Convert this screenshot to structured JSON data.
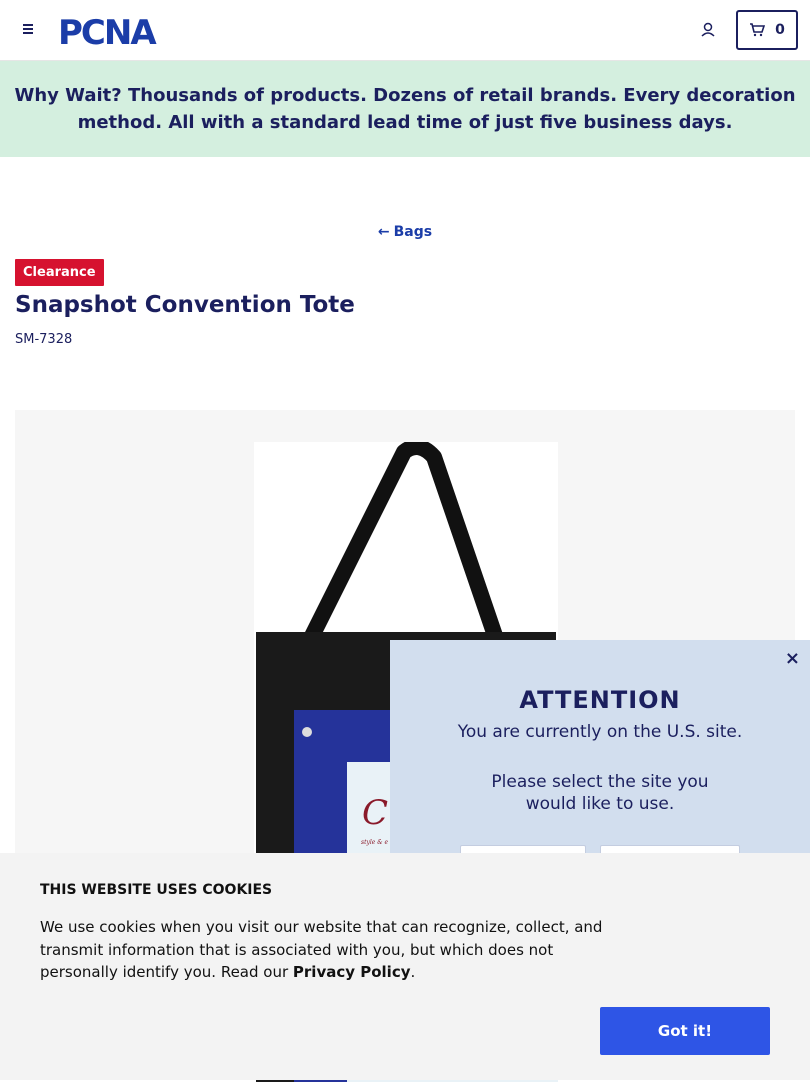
{
  "header": {
    "logo_text": "PCNA",
    "cart_count": "0"
  },
  "promo": {
    "text": "Why Wait? Thousands of products. Dozens of retail brands. Every decoration method. All with a standard lead time of just five business days."
  },
  "breadcrumb": {
    "back_label": "Bags"
  },
  "product": {
    "badge": "Clearance",
    "title": "Snapshot Convention Tote",
    "sku": "SM-7328"
  },
  "attention_modal": {
    "close": "×",
    "title": "ATTENTION",
    "line1": "You are currently on the U.S. site.",
    "line2": "Please select the site you would like to use."
  },
  "cookie_banner": {
    "title": "THIS WEBSITE USES COOKIES",
    "body": "We use cookies when you visit our website that can recognize, collect, and transmit information that is associated with you, but which does not personally identify you. Read our ",
    "link": "Privacy Policy",
    "period": ".",
    "button": "Got it!"
  },
  "colors": {
    "brand_navy": "#1b1f5e",
    "promo_bg": "#d4efdf",
    "clearance_red": "#d6122f",
    "modal_bg": "#d2deee",
    "button_blue": "#2e55e6"
  }
}
